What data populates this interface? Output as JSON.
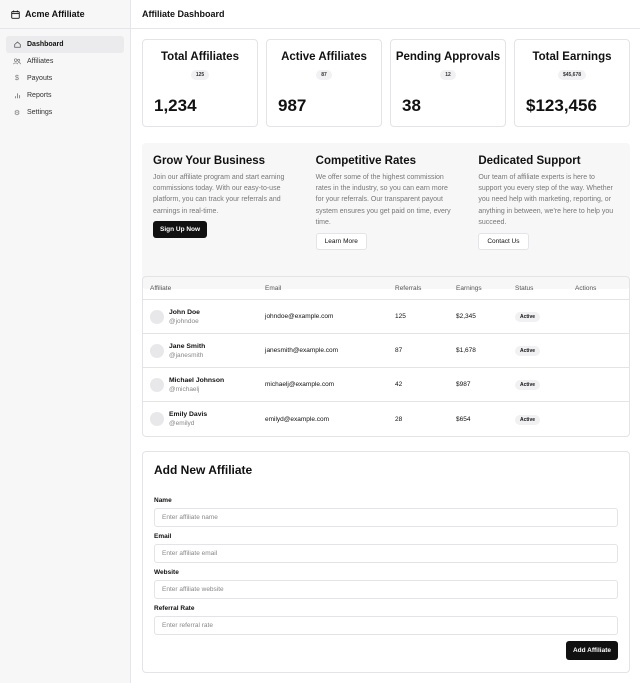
{
  "app": {
    "title": "Acme Affiliate",
    "page_title": "Affiliate Dashboard"
  },
  "sidebar": {
    "items": [
      {
        "label": "Dashboard",
        "icon": "home-icon",
        "active": true
      },
      {
        "label": "Affiliates",
        "icon": "users-icon",
        "active": false
      },
      {
        "label": "Payouts",
        "icon": "dollar-icon",
        "active": false
      },
      {
        "label": "Reports",
        "icon": "bar-chart-icon",
        "active": false
      },
      {
        "label": "Settings",
        "icon": "gear-icon",
        "active": false
      }
    ]
  },
  "stats": [
    {
      "title": "Total Affiliates",
      "badge": "125",
      "value": "1,234"
    },
    {
      "title": "Active Affiliates",
      "badge": "87",
      "value": "987"
    },
    {
      "title": "Pending Approvals",
      "badge": "12",
      "value": "38"
    },
    {
      "title": "Total Earnings",
      "badge": "$45,678",
      "value": "$123,456"
    }
  ],
  "features": [
    {
      "title": "Grow Your Business",
      "text": "Join our affiliate program and start earning commissions today. With our easy-to-use platform, you can track your referrals and earnings in real-time.",
      "button": "Sign Up Now"
    },
    {
      "title": "Competitive Rates",
      "text": "We offer some of the highest commission rates in the industry, so you can earn more for your referrals. Our transparent payout system ensures you get paid on time, every time.",
      "button": "Learn More"
    },
    {
      "title": "Dedicated Support",
      "text": "Our team of affiliate experts is here to support you every step of the way. Whether you need help with marketing, reporting, or anything in between, we're here to help you succeed.",
      "button": "Contact Us"
    }
  ],
  "table": {
    "headers": [
      "Affiliate",
      "Email",
      "Referrals",
      "Earnings",
      "Status",
      "Actions"
    ],
    "rows": [
      {
        "name": "John Doe",
        "handle": "@johndoe",
        "email": "johndoe@example.com",
        "referrals": "125",
        "earnings": "$2,345",
        "status": "Active"
      },
      {
        "name": "Jane Smith",
        "handle": "@janesmith",
        "email": "janesmith@example.com",
        "referrals": "87",
        "earnings": "$1,678",
        "status": "Active"
      },
      {
        "name": "Michael Johnson",
        "handle": "@michaelj",
        "email": "michaelj@example.com",
        "referrals": "42",
        "earnings": "$987",
        "status": "Active"
      },
      {
        "name": "Emily Davis",
        "handle": "@emilyd",
        "email": "emilyd@example.com",
        "referrals": "28",
        "earnings": "$654",
        "status": "Active"
      }
    ]
  },
  "form": {
    "title": "Add New Affiliate",
    "fields": [
      {
        "label": "Name",
        "placeholder": "Enter affiliate name",
        "value": ""
      },
      {
        "label": "Email",
        "placeholder": "Enter affiliate email",
        "value": ""
      },
      {
        "label": "Website",
        "placeholder": "Enter affiliate website",
        "value": ""
      },
      {
        "label": "Referral Rate",
        "placeholder": "Enter referral rate",
        "value": ""
      }
    ],
    "submit": "Add Affiliate"
  }
}
